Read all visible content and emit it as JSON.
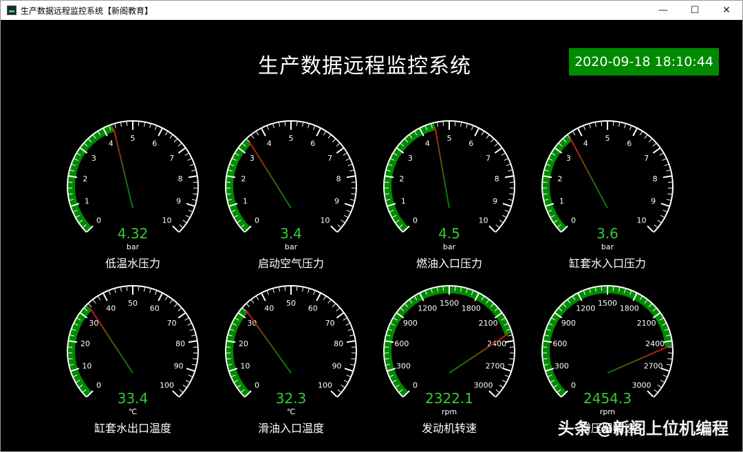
{
  "window": {
    "title": "生产数据远程监控系统【新阁教育】",
    "controls": {
      "minimize": "—",
      "maximize": "☐",
      "close": "✕"
    }
  },
  "header": {
    "title": "生产数据远程监控系统",
    "datetime": "2020-09-18 18:10:44"
  },
  "colors": {
    "background": "#000000",
    "accent_green": "#008a00",
    "value_green": "#33cc33",
    "needle_red": "#cc1111"
  },
  "gauges": [
    {
      "label": "低温水压力",
      "value": 4.32,
      "value_text": "4.32",
      "unit": "bar",
      "min": 0,
      "max": 10,
      "ticks": [
        "0",
        "1",
        "2",
        "3",
        "4",
        "5",
        "6",
        "7",
        "8",
        "9",
        "10"
      ]
    },
    {
      "label": "启动空气压力",
      "value": 3.4,
      "value_text": "3.4",
      "unit": "bar",
      "min": 0,
      "max": 10,
      "ticks": [
        "0",
        "1",
        "2",
        "3",
        "4",
        "5",
        "6",
        "7",
        "8",
        "9",
        "10"
      ]
    },
    {
      "label": "燃油入口压力",
      "value": 4.5,
      "value_text": "4.5",
      "unit": "bar",
      "min": 0,
      "max": 10,
      "ticks": [
        "0",
        "1",
        "2",
        "3",
        "4",
        "5",
        "6",
        "7",
        "8",
        "9",
        "10"
      ]
    },
    {
      "label": "缸套水入口压力",
      "value": 3.6,
      "value_text": "3.6",
      "unit": "bar",
      "min": 0,
      "max": 10,
      "ticks": [
        "0",
        "1",
        "2",
        "3",
        "4",
        "5",
        "6",
        "7",
        "8",
        "9",
        "10"
      ]
    },
    {
      "label": "缸套水出口温度",
      "value": 33.4,
      "value_text": "33.4",
      "unit": "℃",
      "min": 0,
      "max": 100,
      "ticks": [
        "0",
        "10",
        "20",
        "30",
        "40",
        "50",
        "60",
        "70",
        "80",
        "90",
        "100"
      ]
    },
    {
      "label": "滑油入口温度",
      "value": 32.3,
      "value_text": "32.3",
      "unit": "℃",
      "min": 0,
      "max": 100,
      "ticks": [
        "0",
        "10",
        "20",
        "30",
        "40",
        "50",
        "60",
        "70",
        "80",
        "90",
        "100"
      ]
    },
    {
      "label": "发动机转速",
      "value": 2322.1,
      "value_text": "2322.1",
      "unit": "rpm",
      "min": 0,
      "max": 3000,
      "ticks": [
        "0",
        "300",
        "600",
        "900",
        "1200",
        "1500",
        "1800",
        "2100",
        "2400",
        "2700",
        "3000"
      ]
    },
    {
      "label": "增压器转速",
      "value": 2454.3,
      "value_text": "2454.3",
      "unit": "rpm",
      "min": 0,
      "max": 3000,
      "ticks": [
        "0",
        "300",
        "600",
        "900",
        "1200",
        "1500",
        "1800",
        "2100",
        "2400",
        "2700",
        "3000"
      ]
    }
  ],
  "watermark": "头条 @新阁上位机编程"
}
